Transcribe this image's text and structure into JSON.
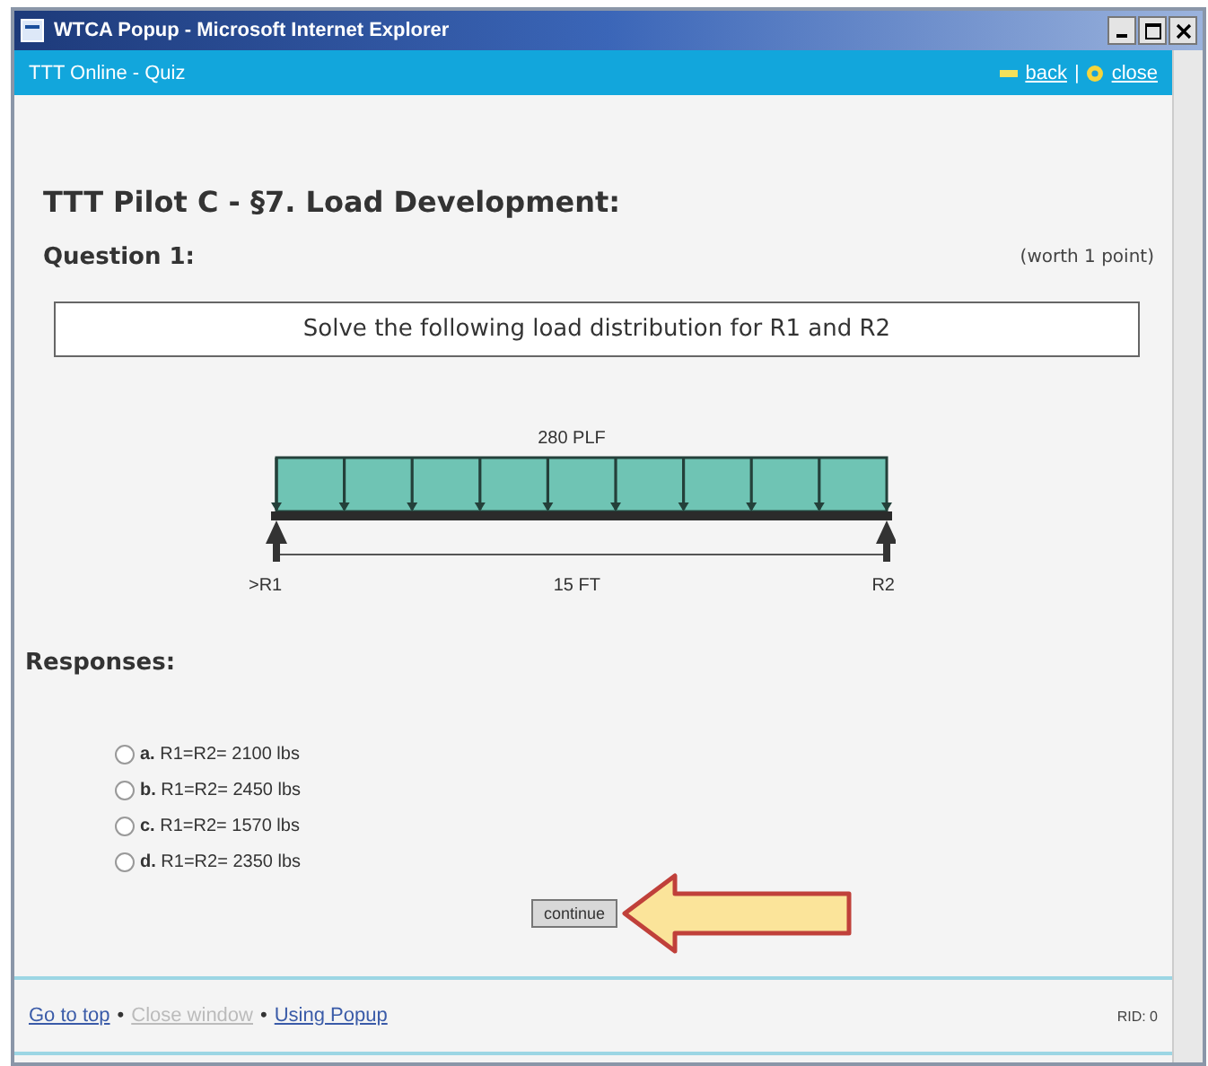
{
  "window": {
    "title": "WTCA Popup - Microsoft Internet Explorer"
  },
  "header": {
    "title": "TTT Online - Quiz",
    "links": [
      {
        "kind": "back",
        "label": "back"
      },
      {
        "kind": "close",
        "label": "close"
      }
    ],
    "separator": "|"
  },
  "heading": "TTT Pilot C - §7. Load Development:",
  "question": {
    "label": "Question 1:",
    "worth": "(worth 1 point)"
  },
  "prompt": "Solve the following load distribution for R1 and R2",
  "diagram": {
    "load_label": "280 PLF",
    "left_label": ">R1",
    "span_label": "15 FT",
    "right_label": "R2"
  },
  "responses": {
    "label": "Responses:",
    "options": [
      {
        "letter": "a.",
        "text": "R1=R2= 2100 lbs",
        "selected": false
      },
      {
        "letter": "b.",
        "text": "R1=R2= 2450 lbs",
        "selected": false
      },
      {
        "letter": "c.",
        "text": "R1=R2= 1570 lbs",
        "selected": false
      },
      {
        "letter": "d.",
        "text": "R1=R2= 2350 lbs",
        "selected": false
      }
    ]
  },
  "button": "continue",
  "footer": {
    "links": [
      {
        "label": "Go to top",
        "disabled": false
      },
      {
        "label": "Close window",
        "disabled": true
      },
      {
        "label": "Using Popup",
        "disabled": false
      }
    ],
    "bullet": "•",
    "status": "RID: 0"
  }
}
